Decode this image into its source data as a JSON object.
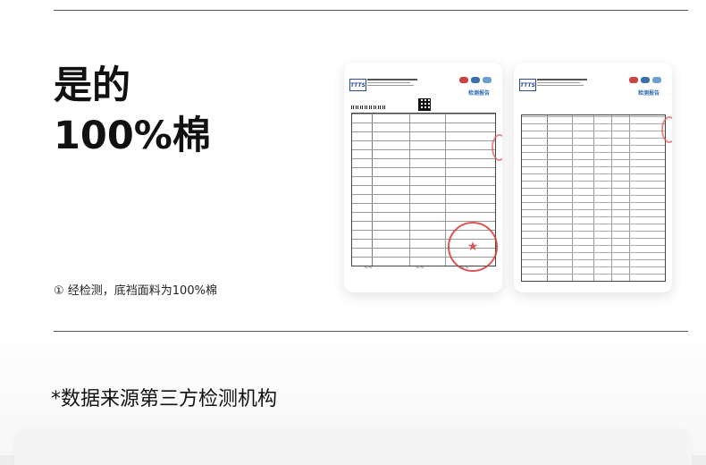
{
  "headline": {
    "line1": "是的",
    "line2": "100%棉"
  },
  "caption": "① 经检测，底裆面料为100%棉",
  "source_note": "*数据来源第三方检测机构",
  "documents": [
    {
      "logo_text": "TTTS",
      "report_title": "检测报告",
      "stamp_icon": "star-icon"
    },
    {
      "logo_text": "TTTS",
      "report_title": "检测报告",
      "stamp_icon": "none"
    }
  ],
  "colors": {
    "background": "#ededed",
    "card": "#ffffff",
    "text": "#111111",
    "stamp": "#d93a3a",
    "doc_title": "#2b6bb0"
  }
}
